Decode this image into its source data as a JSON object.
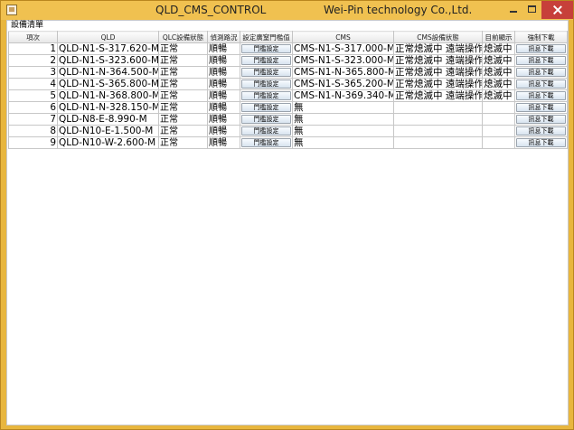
{
  "window": {
    "title_left": "QLD_CMS_CONTROL",
    "title_right": "Wei-Pin technology Co.,Ltd."
  },
  "group_label": "設備清單",
  "columns": [
    "項次",
    "QLD",
    "QLC設備狀態",
    "偵測路況",
    "設定廣窒門檻值",
    "CMS",
    "CMS設備狀態",
    "目前顯示",
    "強制下載"
  ],
  "rows": [
    {
      "index": "1",
      "qld": "QLD-N1-S-317.620-M",
      "qlc_status": "正常",
      "traffic": "順暢",
      "threshold_button": "門檻設定",
      "cms": "CMS-N1-S-317.000-M",
      "cms_status": "正常熄滅中 遠端操作",
      "display": "熄滅中",
      "download_button": "訊息下載"
    },
    {
      "index": "2",
      "qld": "QLD-N1-S-323.600-M",
      "qlc_status": "正常",
      "traffic": "順暢",
      "threshold_button": "門檻設定",
      "cms": "CMS-N1-S-323.000-M",
      "cms_status": "正常熄滅中 遠端操作",
      "display": "熄滅中",
      "download_button": "訊息下載"
    },
    {
      "index": "3",
      "qld": "QLD-N1-N-364.500-M",
      "qlc_status": "正常",
      "traffic": "順暢",
      "threshold_button": "門檻設定",
      "cms": "CMS-N1-N-365.800-M",
      "cms_status": "正常熄滅中 遠端操作",
      "display": "熄滅中",
      "download_button": "訊息下載"
    },
    {
      "index": "4",
      "qld": "QLD-N1-S-365.800-M",
      "qlc_status": "正常",
      "traffic": "順暢",
      "threshold_button": "門檻設定",
      "cms": "CMS-N1-S-365.200-M",
      "cms_status": "正常熄滅中 遠端操作",
      "display": "熄滅中",
      "download_button": "訊息下載"
    },
    {
      "index": "5",
      "qld": "QLD-N1-N-368.800-M",
      "qlc_status": "正常",
      "traffic": "順暢",
      "threshold_button": "門檻設定",
      "cms": "CMS-N1-N-369.340-M",
      "cms_status": "正常熄滅中 遠端操作",
      "display": "熄滅中",
      "download_button": "訊息下載"
    },
    {
      "index": "6",
      "qld": "QLD-N1-N-328.150-M",
      "qlc_status": "正常",
      "traffic": "順暢",
      "threshold_button": "門檻設定",
      "cms": "無",
      "cms_status": "",
      "display": "",
      "download_button": "訊息下載"
    },
    {
      "index": "7",
      "qld": "QLD-N8-E-8.990-M",
      "qlc_status": "正常",
      "traffic": "順暢",
      "threshold_button": "門檻設定",
      "cms": "無",
      "cms_status": "",
      "display": "",
      "download_button": "訊息下載"
    },
    {
      "index": "8",
      "qld": "QLD-N10-E-1.500-M",
      "qlc_status": "正常",
      "traffic": "順暢",
      "threshold_button": "門檻設定",
      "cms": "無",
      "cms_status": "",
      "display": "",
      "download_button": "訊息下載"
    },
    {
      "index": "9",
      "qld": "QLD-N10-W-2.600-M",
      "qlc_status": "正常",
      "traffic": "順暢",
      "threshold_button": "門檻設定",
      "cms": "無",
      "cms_status": "",
      "display": "",
      "download_button": "訊息下載"
    }
  ]
}
